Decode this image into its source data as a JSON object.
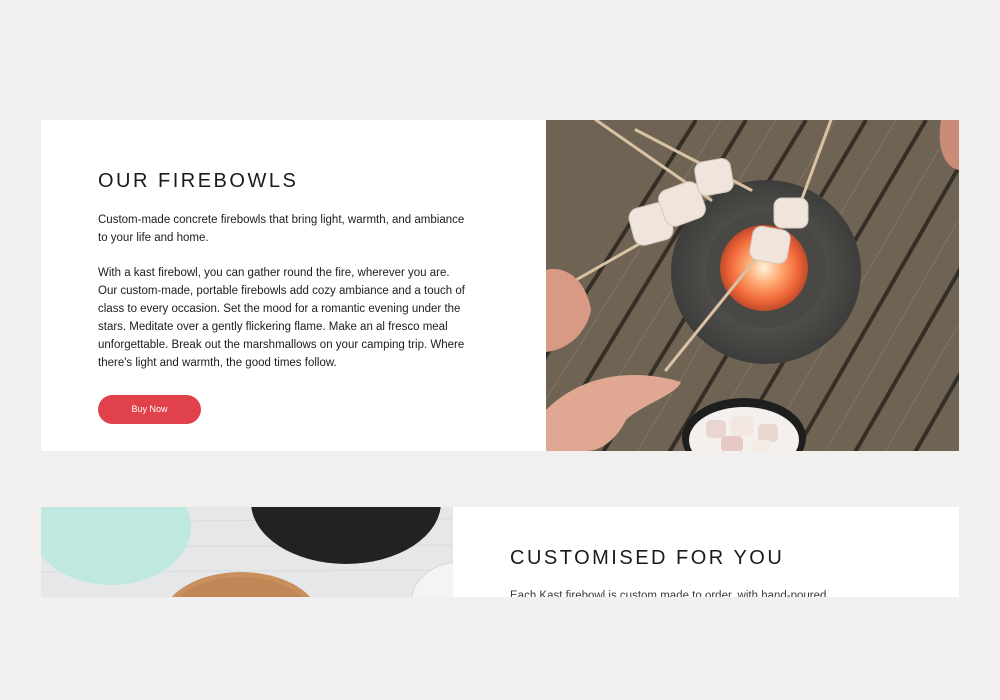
{
  "section1": {
    "title": "OUR FIREBOWLS",
    "intro": "Custom-made concrete firebowls that bring light, warmth, and ambiance to your life and home.",
    "body": "With a kast firebowl, you can gather round the fire, wherever you are. Our custom-made, portable firebowls add cozy ambiance and a touch of class to every occasion. Set the mood for a romantic evening under the stars. Meditate over a gently flickering flame. Make an al fresco meal unforgettable. Break out the marshmallows on your camping trip. Where there's light and warmth, the good times follow.",
    "button_label": "Buy Now",
    "accent_color": "#e0414b",
    "image_icon": "firebowl-marshmallows-photo"
  },
  "section2": {
    "title": "CUSTOMISED FOR YOU",
    "body": "Each Kast firebowl is custom made to order, with hand-poured",
    "image_icon": "concrete-coasters-photo"
  }
}
